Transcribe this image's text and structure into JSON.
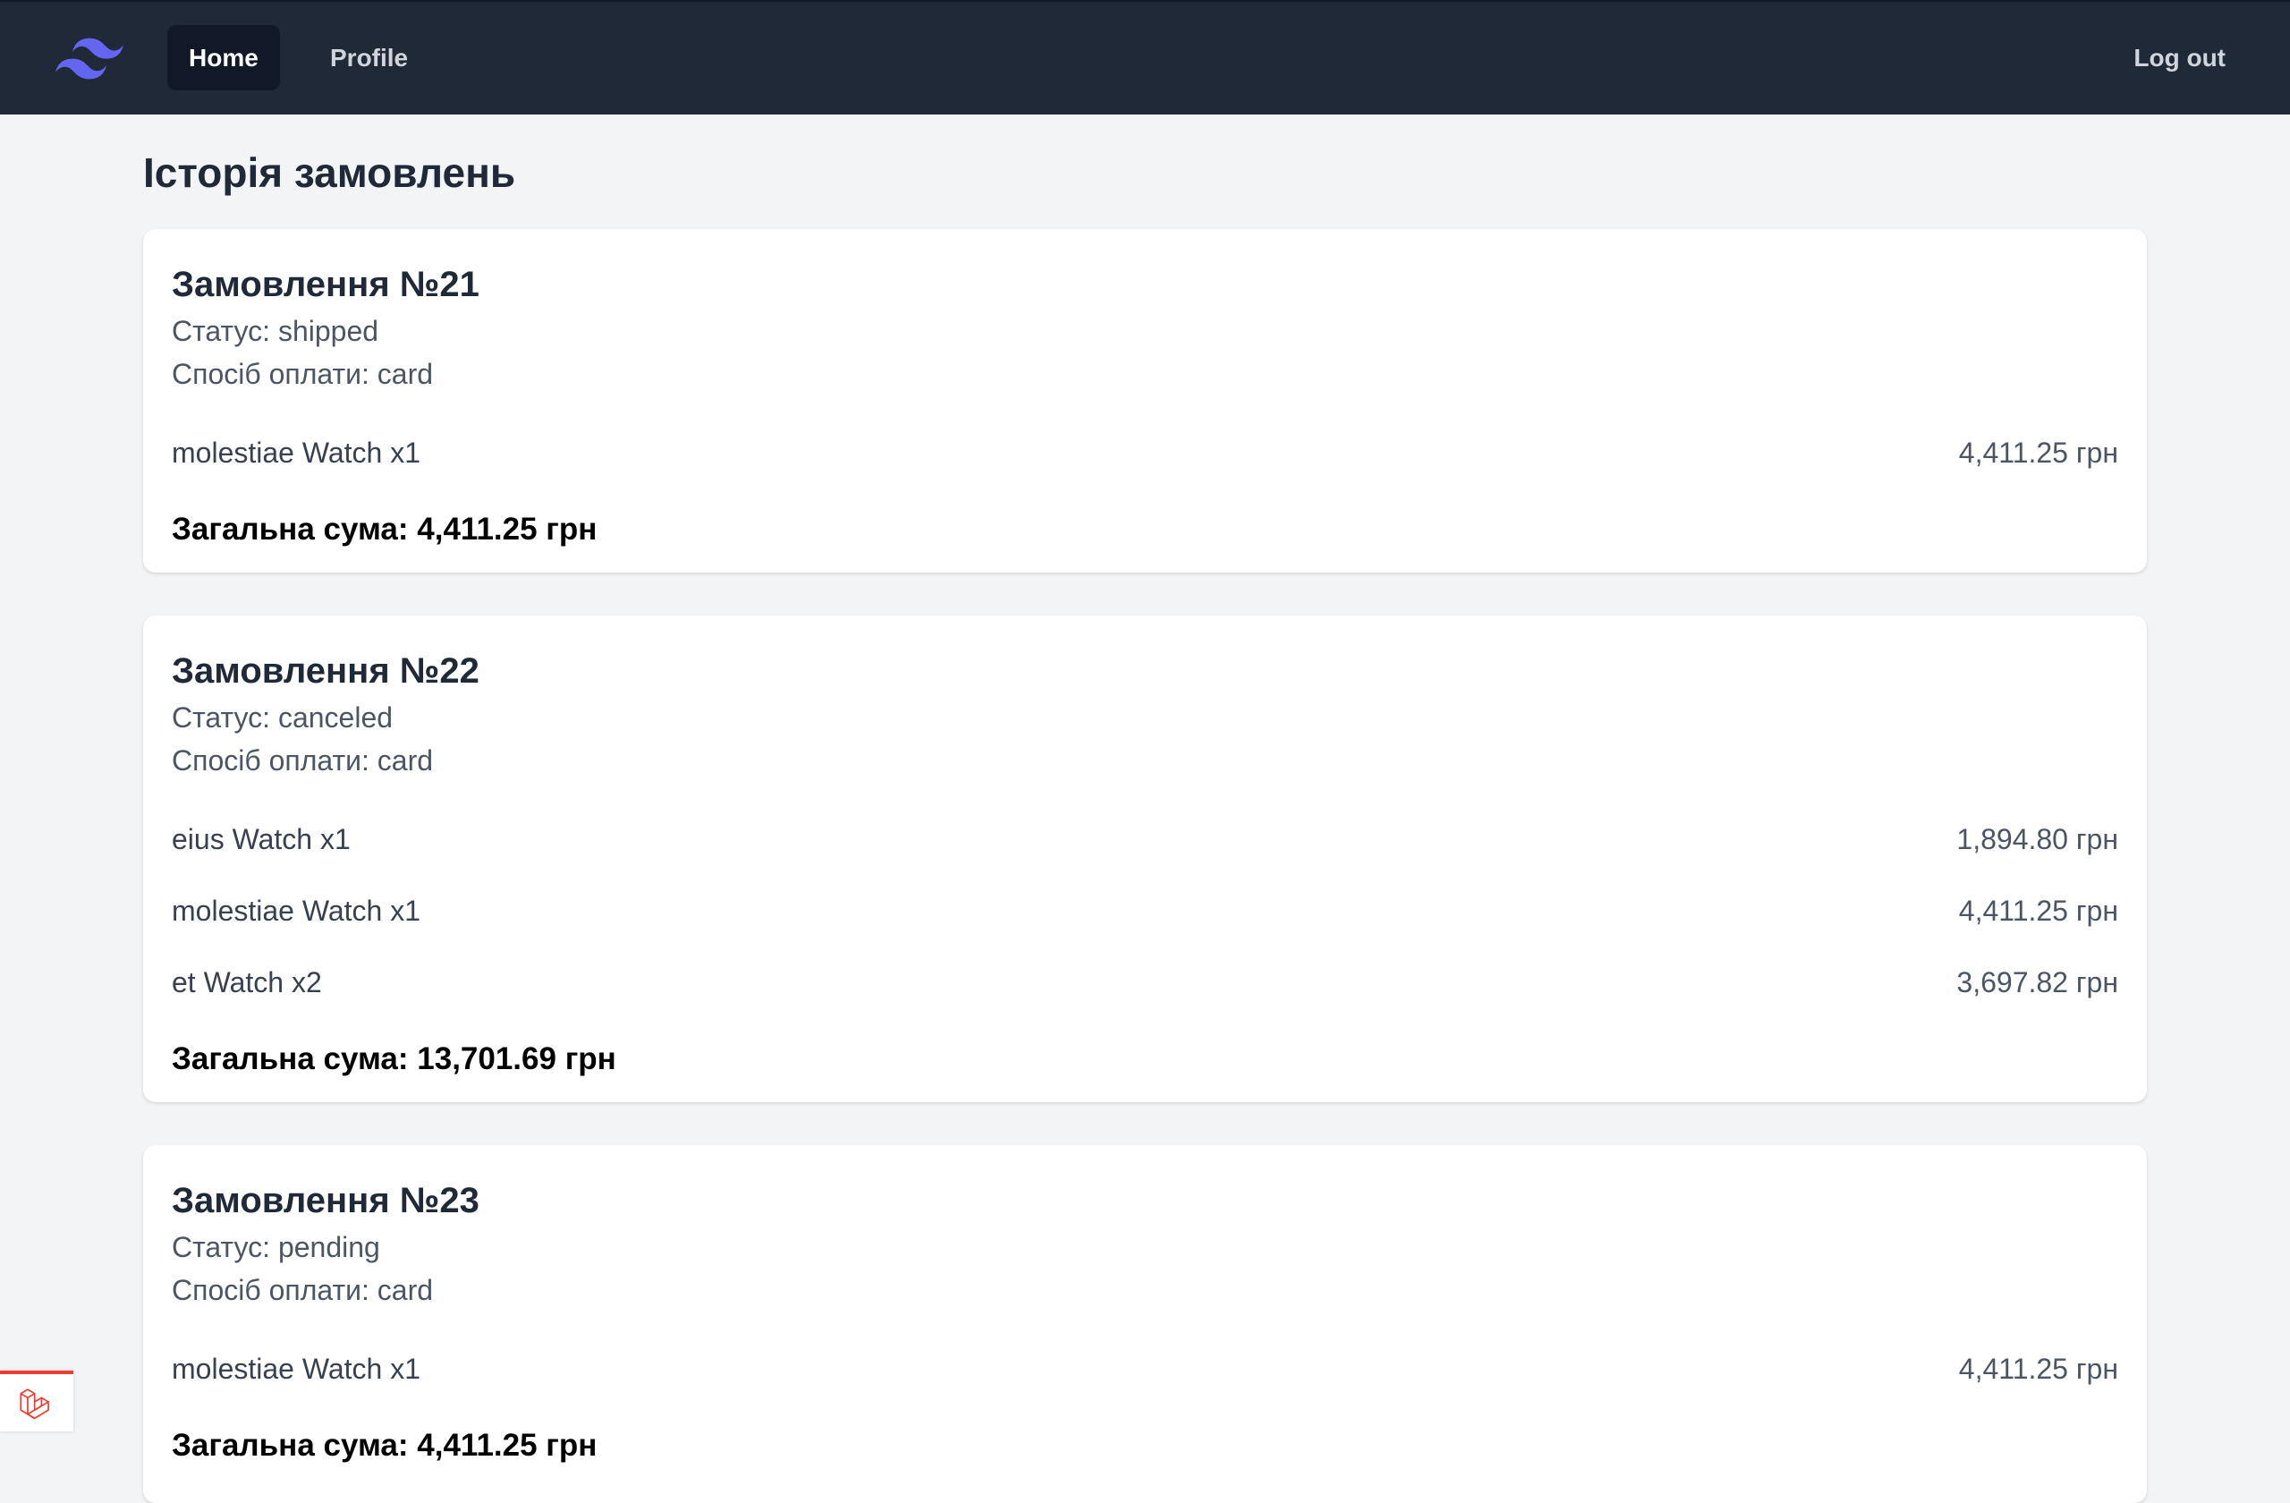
{
  "nav": {
    "home": "Home",
    "profile": "Profile",
    "logout": "Log out"
  },
  "page": {
    "title": "Історія замовлень"
  },
  "orders": [
    {
      "title": "Замовлення №21",
      "status": "Статус: shipped",
      "payment": "Спосіб оплати: card",
      "items": [
        {
          "name": "molestiae Watch x1",
          "price": "4,411.25 грн"
        }
      ],
      "total": "Загальна сума: 4,411.25 грн"
    },
    {
      "title": "Замовлення №22",
      "status": "Статус: canceled",
      "payment": "Спосіб оплати: card",
      "items": [
        {
          "name": "eius Watch x1",
          "price": "1,894.80 грн"
        },
        {
          "name": "molestiae Watch x1",
          "price": "4,411.25 грн"
        },
        {
          "name": "et Watch x2",
          "price": "3,697.82 грн"
        }
      ],
      "total": "Загальна сума: 13,701.69 грн"
    },
    {
      "title": "Замовлення №23",
      "status": "Статус: pending",
      "payment": "Спосіб оплати: card",
      "items": [
        {
          "name": "molestiae Watch x1",
          "price": "4,411.25 грн"
        }
      ],
      "total": "Загальна сума: 4,411.25 грн"
    }
  ],
  "colors": {
    "nav_bg": "#1f2937",
    "nav_active_bg": "#111827",
    "page_bg": "#f3f4f6",
    "logo": "#6366f1",
    "laravel_red": "#ef3b2d"
  },
  "icons": {
    "logo": "tailwind-logo-icon",
    "debugbar": "laravel-icon"
  }
}
